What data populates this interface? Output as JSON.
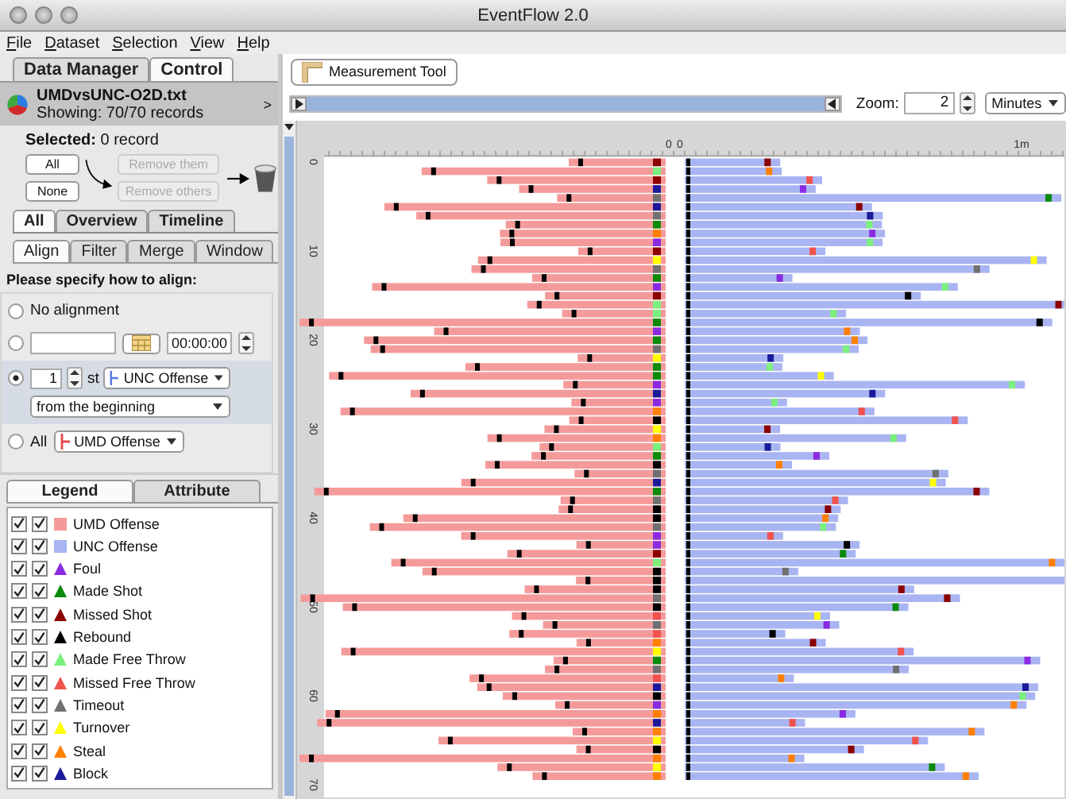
{
  "window": {
    "title": "EventFlow 2.0"
  },
  "menu": [
    "File",
    "Dataset",
    "Selection",
    "View",
    "Help"
  ],
  "panel_tabs": [
    {
      "label": "Data Manager",
      "selected": false
    },
    {
      "label": "Control",
      "selected": true
    }
  ],
  "dataset": {
    "name": "UMDvsUNC-O2D.txt",
    "showing": "Showing: 70/70 records",
    "chevron": ">"
  },
  "selection": {
    "label": "Selected:",
    "value": "0 record"
  },
  "select_buttons": [
    "All",
    "None"
  ],
  "remove_buttons": [
    {
      "label": "Remove them",
      "disabled": true
    },
    {
      "label": "Remove others",
      "disabled": true
    }
  ],
  "view_tabs": [
    {
      "label": "All",
      "selected": true
    },
    {
      "label": "Overview",
      "selected": false
    },
    {
      "label": "Timeline",
      "selected": false
    }
  ],
  "sub_tabs": [
    {
      "label": "Align",
      "selected": true
    },
    {
      "label": "Filter",
      "selected": false
    },
    {
      "label": "Merge",
      "selected": false
    },
    {
      "label": "Window",
      "selected": false
    }
  ],
  "align": {
    "heading": "Please specify how to align:",
    "options": [
      {
        "kind": "none",
        "label": "No alignment",
        "selected": false
      },
      {
        "kind": "date",
        "time": "00:00:00",
        "selected": false
      },
      {
        "kind": "nth",
        "number": "1",
        "suffix": "st",
        "event": "UNC Offense",
        "from": "from the beginning",
        "selected": true
      },
      {
        "kind": "all",
        "label": "All",
        "event": "UMD Offense",
        "selected": false
      }
    ]
  },
  "legend_tabs": [
    {
      "label": "Legend",
      "selected": true
    },
    {
      "label": "Attribute",
      "selected": false
    }
  ],
  "legend": [
    {
      "label": "UMD Offense",
      "kind": "square",
      "color": "#f59a9a",
      "check_1": true,
      "check_2": true
    },
    {
      "label": "UNC Offense",
      "kind": "square",
      "color": "#a9b4f2",
      "check_1": true,
      "check_2": true
    },
    {
      "label": "Foul",
      "kind": "triangle",
      "color": "#8a2be2",
      "check_1": true,
      "check_2": true
    },
    {
      "label": "Made Shot",
      "kind": "triangle",
      "color": "#0a8a0a",
      "check_1": true,
      "check_2": true
    },
    {
      "label": "Missed Shot",
      "kind": "triangle",
      "color": "#8b0000",
      "check_1": true,
      "check_2": true
    },
    {
      "label": "Rebound",
      "kind": "triangle",
      "color": "#000000",
      "check_1": true,
      "check_2": true
    },
    {
      "label": "Made Free Throw",
      "kind": "triangle",
      "color": "#7cf07c",
      "check_1": true,
      "check_2": true
    },
    {
      "label": "Missed Free Throw",
      "kind": "triangle",
      "color": "#f0524e",
      "check_1": true,
      "check_2": true
    },
    {
      "label": "Timeout",
      "kind": "triangle",
      "color": "#707070",
      "check_1": true,
      "check_2": true
    },
    {
      "label": "Turnover",
      "kind": "triangle",
      "color": "#ffff00",
      "check_1": true,
      "check_2": true
    },
    {
      "label": "Steal",
      "kind": "triangle",
      "color": "#ff7f00",
      "check_1": true,
      "check_2": true
    },
    {
      "label": "Block",
      "kind": "triangle",
      "color": "#1a1a9a",
      "check_1": true,
      "check_2": true
    }
  ],
  "measurement_tool": "Measurement Tool",
  "range_slider": {
    "level": 1
  },
  "zoom": {
    "label": "Zoom:",
    "value": "2",
    "unit": "Minutes"
  },
  "ruler": {
    "x_labels": [
      "0",
      "0",
      "1m"
    ],
    "y_labels": [
      "0",
      "10",
      "20",
      "30",
      "40",
      "50",
      "60",
      "70"
    ]
  }
}
